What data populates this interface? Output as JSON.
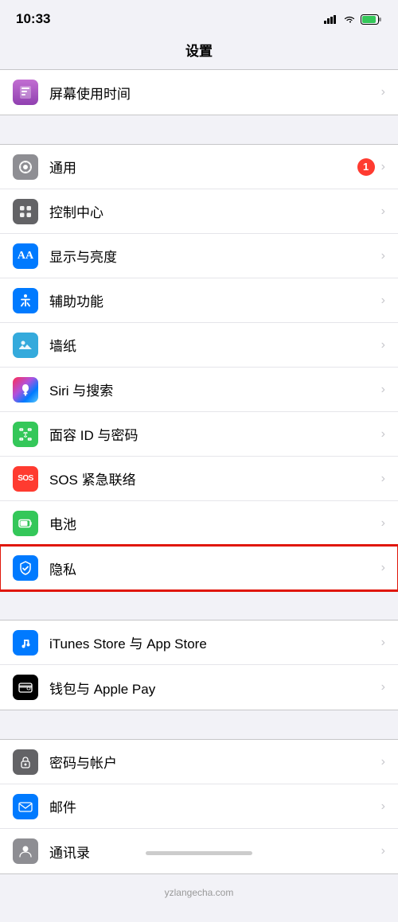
{
  "statusBar": {
    "time": "10:33"
  },
  "header": {
    "title": "设置"
  },
  "sections": [
    {
      "id": "section1",
      "items": [
        {
          "id": "screen-time",
          "label": "屏幕使用时间",
          "iconBg": "icon-purple-sand",
          "iconColor": "#bf5af2",
          "iconSymbol": "⏳"
        }
      ]
    },
    {
      "id": "section2",
      "items": [
        {
          "id": "general",
          "label": "通用",
          "iconBg": "#8e8e93",
          "iconSymbol": "⚙️",
          "badge": "1"
        },
        {
          "id": "control-center",
          "label": "控制中心",
          "iconBg": "#636366",
          "iconSymbol": "⊞"
        },
        {
          "id": "display",
          "label": "显示与亮度",
          "iconBg": "#007aff",
          "iconSymbol": "AA"
        },
        {
          "id": "accessibility",
          "label": "辅助功能",
          "iconBg": "#007aff",
          "iconSymbol": "♿"
        },
        {
          "id": "wallpaper",
          "label": "墙纸",
          "iconBg": "#34aadc",
          "iconSymbol": "❋"
        },
        {
          "id": "siri",
          "label": "Siri 与搜索",
          "iconBg": "#000",
          "iconSymbol": "🎤"
        },
        {
          "id": "faceid",
          "label": "面容 ID 与密码",
          "iconBg": "#34c759",
          "iconSymbol": "😊"
        },
        {
          "id": "sos",
          "label": "SOS 紧急联络",
          "iconBg": "#ff3b30",
          "iconSymbol": "SOS"
        },
        {
          "id": "battery",
          "label": "电池",
          "iconBg": "#34c759",
          "iconSymbol": "🔋"
        },
        {
          "id": "privacy",
          "label": "隐私",
          "iconBg": "#007aff",
          "iconSymbol": "✋",
          "highlighted": true
        }
      ]
    },
    {
      "id": "section3",
      "items": [
        {
          "id": "itunes",
          "label": "iTunes Store 与 App Store",
          "iconBg": "#007aff",
          "iconSymbol": "🅐"
        },
        {
          "id": "wallet",
          "label": "钱包与 Apple Pay",
          "iconBg": "#000",
          "iconSymbol": "💳"
        }
      ]
    },
    {
      "id": "section4",
      "items": [
        {
          "id": "passwords",
          "label": "密码与帐户",
          "iconBg": "#636366",
          "iconSymbol": "🔑"
        },
        {
          "id": "mail",
          "label": "邮件",
          "iconBg": "#007aff",
          "iconSymbol": "✉"
        },
        {
          "id": "contacts",
          "label": "通讯录",
          "iconBg": "#8e8e93",
          "iconSymbol": "👤"
        }
      ]
    }
  ],
  "watermark": "yzlangecha.com"
}
